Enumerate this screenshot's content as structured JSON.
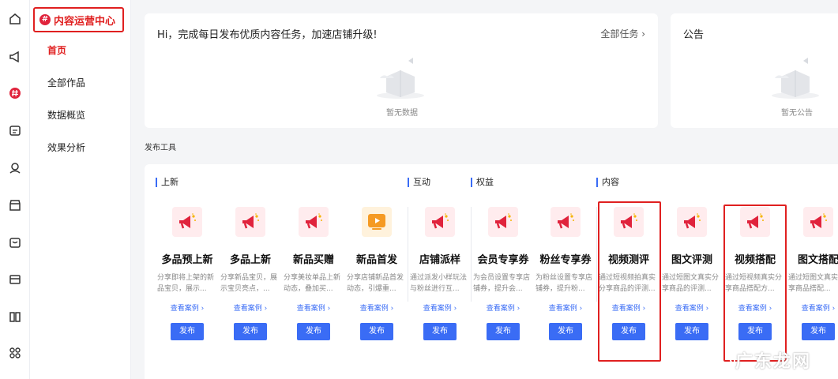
{
  "sidebar": {
    "icons": [
      "home-icon",
      "megaphone-icon",
      "content-hub-icon",
      "calendar-icon",
      "person-icon",
      "store-icon",
      "box-icon",
      "card-icon",
      "book-icon",
      "apps-icon"
    ],
    "header": "内容运营中心",
    "items": [
      {
        "label": "首页",
        "active": true
      },
      {
        "label": "全部作品"
      },
      {
        "label": "数据概览"
      },
      {
        "label": "效果分析"
      }
    ]
  },
  "tasks": {
    "title": "Hi，完成每日发布优质内容任务，加速店铺升级!",
    "more": "全部任务 ›",
    "empty": "暂无数据"
  },
  "notice": {
    "title": "公告",
    "empty": "暂无公告"
  },
  "tools": {
    "section_label": "发布工具",
    "groups": [
      {
        "label": "上新"
      },
      {
        "label": "互动"
      },
      {
        "label": "权益"
      },
      {
        "label": "内容"
      }
    ],
    "items": [
      {
        "name": "多品预上新",
        "desc": "分享即将上架的新品宝贝，展示...",
        "link": "查看案例 ›",
        "button": "发布",
        "icon": "megaphone-icon"
      },
      {
        "name": "多品上新",
        "desc": "分享新品宝贝，展示宝贝亮点，...",
        "link": "查看案例 ›",
        "button": "发布",
        "icon": "megaphone-icon"
      },
      {
        "name": "新品买赠",
        "desc": "分享美妆单品上新动态，叠加买...",
        "link": "查看案例 ›",
        "button": "发布",
        "icon": "megaphone-icon"
      },
      {
        "name": "新品首发",
        "desc": "分享店铺新品首发动态，引爆重...",
        "link": "查看案例 ›",
        "button": "发布",
        "icon": "play-icon"
      },
      {
        "name": "店铺派样",
        "desc": "通过派发小样玩法与粉丝进行互...",
        "link": "查看案例 ›",
        "button": "发布",
        "icon": "megaphone-icon"
      },
      {
        "name": "会员专享券",
        "desc": "为会员设置专享店铺券，提升会...",
        "link": "查看案例 ›",
        "button": "发布",
        "icon": "megaphone-icon"
      },
      {
        "name": "粉丝专享券",
        "desc": "为粉丝设置专享店铺券，提升粉...",
        "link": "查看案例 ›",
        "button": "发布",
        "icon": "megaphone-icon"
      },
      {
        "name": "视频测评",
        "desc": "通过短视频拍真实分享商品的评测...",
        "link": "查看案例 ›",
        "button": "发布",
        "icon": "megaphone-icon"
      },
      {
        "name": "图文评测",
        "desc": "通过短图文真实分享商品的评测...",
        "link": "查看案例 ›",
        "button": "发布",
        "icon": "megaphone-icon"
      },
      {
        "name": "视频搭配",
        "desc": "通过短视频真实分享商品搭配方...",
        "link": "查看案例 ›",
        "button": "发布",
        "icon": "megaphone-icon"
      },
      {
        "name": "图文搭配",
        "desc": "通过短图文真实分享商品搭配...",
        "link": "查看案例 ›",
        "button": "发布",
        "icon": "megaphone-icon"
      }
    ]
  },
  "watermark": "广东龙网",
  "colors": {
    "accent": "#3a6cf5",
    "brand_red": "#e02020"
  }
}
